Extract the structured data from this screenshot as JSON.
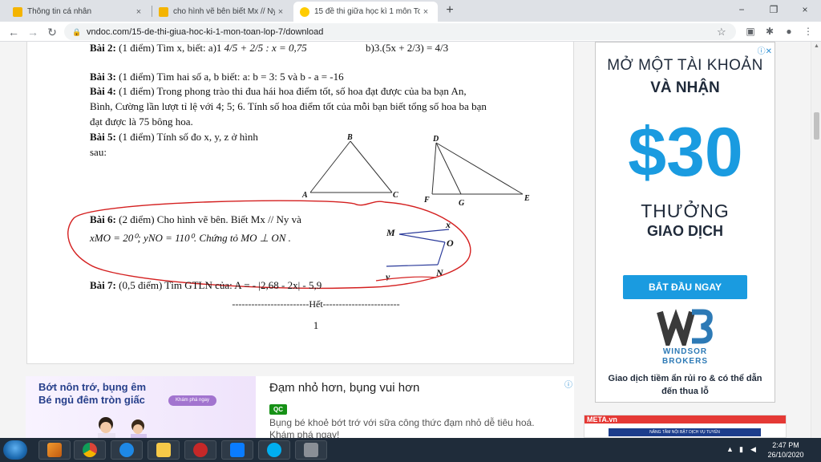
{
  "browser": {
    "tabs": [
      {
        "title": "Thông tin cá nhân",
        "close": "×"
      },
      {
        "title": "cho hình vẽ bên biết Mx // Ny gó",
        "close": "×"
      },
      {
        "title": "15 đề thi giữa học kì 1 môn Toán",
        "close": "×"
      }
    ],
    "new_tab": "+",
    "window_controls": {
      "minimize": "−",
      "restore": "❐",
      "close": "×"
    },
    "back": "←",
    "forward": "→",
    "reload": "↻",
    "url": "vndoc.com/15-de-thi-giua-hoc-ki-1-mon-toan-lop-7/download",
    "accent": "#1a73e8"
  },
  "document": {
    "bai2": {
      "label": "Bài 2:",
      "text": "(1 điểm) Tìm x, biết: a)1",
      "frac": "4/5 + 2/5 : x = 0,75",
      "b": "b)3.(5x + 2/3) = 4/3"
    },
    "bai3": {
      "label": "Bài 3:",
      "text": "(1 điểm) Tìm hai số a, b biết: a: b = 3: 5 và b - a =  -16"
    },
    "bai4": {
      "label": "Bài 4:",
      "line1": "(1 điểm) Trong phong trào thi đua hái hoa điểm tốt, số hoa đạt được của ba bạn An,",
      "line2": "Bình, Cường lần lượt tỉ lệ với 4; 5; 6. Tính số hoa điểm tốt của mỗi bạn biết tổng số hoa ba bạn",
      "line3": "đạt được là 75 bông hoa."
    },
    "bai5": {
      "label": "Bài 5:",
      "line1": "(1 điểm) Tính số đo x, y, z ở hình",
      "line2": "sau:"
    },
    "bai6": {
      "label": "Bài 6:",
      "line1": "(2 điểm) Cho hình vẽ bên. Biết Mx // Ny và",
      "line2": "xMO = 20⁰; yNO = 110⁰. Chứng tỏ  MO ⊥ ON ."
    },
    "bai7": {
      "label": "Bài 7:",
      "text": "(0,5 điểm) Tìm GTLN của: A = - |2,68 - 2x| - 5,9"
    },
    "end": "------------------------Hết------------------------",
    "page_number": "1",
    "fig_labels": {
      "A": "A",
      "B": "B",
      "C": "C",
      "D": "D",
      "E": "E",
      "F": "F",
      "G": "G",
      "M": "M",
      "N": "N",
      "O": "O",
      "x": "x",
      "y": "y"
    }
  },
  "ad_right": {
    "info": "ⓘ✕",
    "headline1": "MỞ MỘT TÀI KHOẢN",
    "headline2": "VÀ NHẬN",
    "amount": "$30",
    "reward1": "THƯỞNG",
    "reward2": "GIAO DỊCH",
    "cta": "BẮT ĐẦU NGAY",
    "brand1": "WINDSOR",
    "brand2": "BROKERS",
    "disclaimer": "Giao dịch tiềm ẩn rủi ro & có thể dẫn đến thua lỗ",
    "accent": "#1a9be0"
  },
  "ad_bottom": {
    "banner_line1": "Bớt nôn trớ, bụng êm",
    "banner_line2": "Bé ngủ đêm tròn giấc",
    "banner_pill": "Khám phá ngay",
    "title": "Đạm nhỏ hơn, bụng vui hơn",
    "qc": "QC",
    "desc": "Bụng bé khoẻ bớt trớ với sữa công thức đạm nhỏ dễ tiêu hoá. Khám phá ngay!",
    "info": "ⓘ"
  },
  "ad_meta": {
    "logo": "META.vn",
    "strip": "NÂNG TẦM NỘI BẬT DỊCH VỤ TUYỂN"
  },
  "taskbar": {
    "time": "2:47 PM",
    "date": "26/10/2020",
    "tray_arrow": "▲",
    "apps": [
      "media-player",
      "chrome",
      "internet-explorer",
      "file-explorer",
      "emblem",
      "zalo",
      "skype",
      "app-gray"
    ]
  }
}
